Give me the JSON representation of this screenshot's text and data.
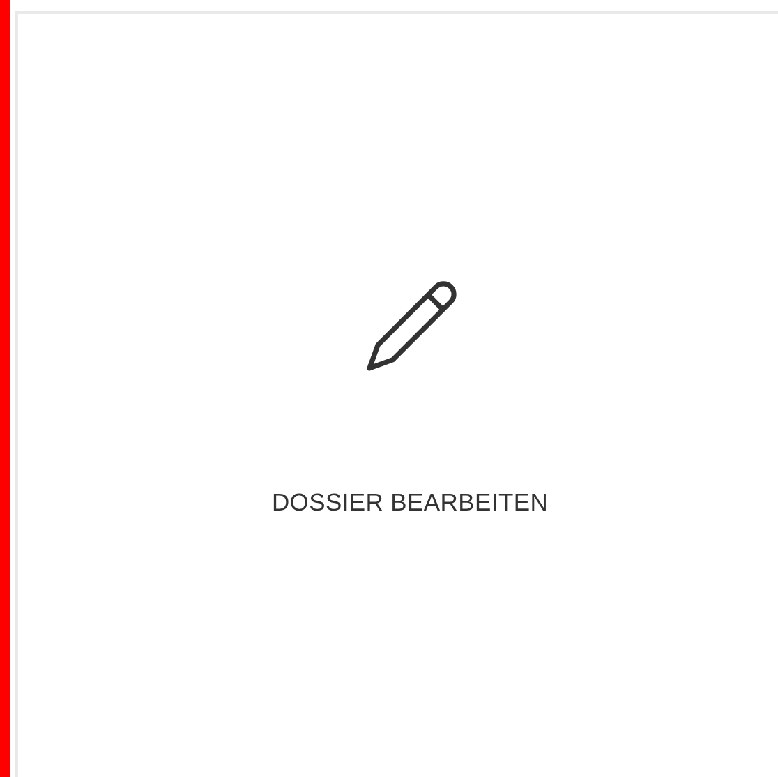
{
  "tile": {
    "label": "DOSSIER BEARBEITEN"
  }
}
